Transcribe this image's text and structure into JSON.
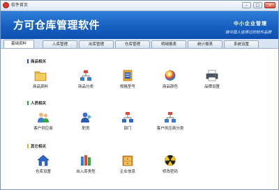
{
  "window": {
    "title": "软件首页",
    "buttons": {
      "minimize": "–",
      "maximize": "□",
      "close": "×"
    }
  },
  "banner": {
    "app_title": "方可仓库管理软件",
    "slogan": "中小企业管理",
    "tagline": "做中国人信得过的软件品牌"
  },
  "tabs": [
    {
      "label": "基础资料",
      "active": true
    },
    {
      "label": "入库管理",
      "active": false
    },
    {
      "label": "出库管理",
      "active": false
    },
    {
      "label": "仓库管理",
      "active": false
    },
    {
      "label": "明细报表",
      "active": false
    },
    {
      "label": "统计报表",
      "active": false
    },
    {
      "label": "系统设置",
      "active": false
    }
  ],
  "sections": [
    {
      "title": "商品相关",
      "accent": "#1e56c8",
      "items": [
        {
          "label": "商品资料",
          "icon": "folder-icon"
        },
        {
          "label": "商品分类",
          "icon": "hierarchy-icon"
        },
        {
          "label": "规格型号",
          "icon": "book-icon"
        },
        {
          "label": "商品颜色",
          "icon": "color-ball-icon"
        },
        {
          "label": "品牌设置",
          "icon": "printer-icon"
        }
      ]
    },
    {
      "title": "人员相关",
      "accent": "#2ea32e",
      "items": [
        {
          "label": "客户供应商",
          "icon": "people-icon"
        },
        {
          "label": "职员",
          "icon": "staff-icon"
        },
        {
          "label": "部门",
          "icon": "department-icon"
        },
        {
          "label": "客户供应商分类",
          "icon": "hierarchy-icon"
        }
      ]
    },
    {
      "title": "其它相关",
      "accent": "#e3b21e",
      "items": [
        {
          "label": "仓库设置",
          "icon": "house-icon"
        },
        {
          "label": "出入库类型",
          "icon": "books-icon"
        },
        {
          "label": "企业信息",
          "icon": "cabinet-icon"
        },
        {
          "label": "修改密码",
          "icon": "radiation-icon"
        }
      ]
    }
  ]
}
